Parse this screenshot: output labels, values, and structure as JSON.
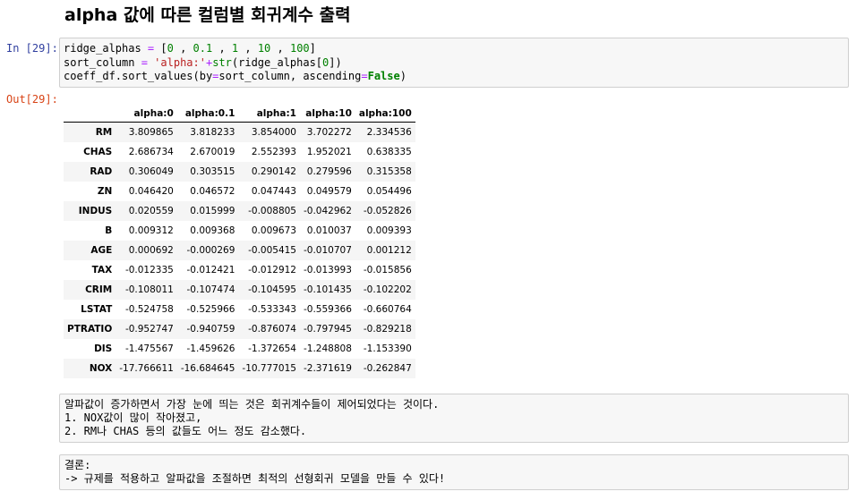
{
  "heading": "alpha 값에 따른 컬럼별 회귀계수 출력",
  "cell_in": {
    "prompt": "In [29]:",
    "line1": {
      "a": "ridge_alphas ",
      "b": "=",
      "c": " [",
      "d": "0",
      "e": " , ",
      "f": "0.1",
      "g": " , ",
      "h": "1",
      "i": " , ",
      "j": "10",
      "k": " , ",
      "l": "100",
      "m": "]"
    },
    "line2": {
      "a": "sort_column ",
      "b": "=",
      "c": " ",
      "d": "'alpha:'",
      "e": "+",
      "f": "str",
      "g": "(ridge_alphas[",
      "h": "0",
      "i": "])"
    },
    "line3": {
      "a": "coeff_df.sort_values(by",
      "b": "=",
      "c": "sort_column, ascending",
      "d": "=",
      "e": "False",
      "f": ")"
    }
  },
  "cell_out": {
    "prompt": "Out[29]:",
    "columns": [
      "",
      "alpha:0",
      "alpha:0.1",
      "alpha:1",
      "alpha:10",
      "alpha:100"
    ],
    "rows": [
      {
        "label": "RM",
        "values": [
          "3.809865",
          "3.818233",
          "3.854000",
          "3.702272",
          "2.334536"
        ]
      },
      {
        "label": "CHAS",
        "values": [
          "2.686734",
          "2.670019",
          "2.552393",
          "1.952021",
          "0.638335"
        ]
      },
      {
        "label": "RAD",
        "values": [
          "0.306049",
          "0.303515",
          "0.290142",
          "0.279596",
          "0.315358"
        ]
      },
      {
        "label": "ZN",
        "values": [
          "0.046420",
          "0.046572",
          "0.047443",
          "0.049579",
          "0.054496"
        ]
      },
      {
        "label": "INDUS",
        "values": [
          "0.020559",
          "0.015999",
          "-0.008805",
          "-0.042962",
          "-0.052826"
        ]
      },
      {
        "label": "B",
        "values": [
          "0.009312",
          "0.009368",
          "0.009673",
          "0.010037",
          "0.009393"
        ]
      },
      {
        "label": "AGE",
        "values": [
          "0.000692",
          "-0.000269",
          "-0.005415",
          "-0.010707",
          "0.001212"
        ]
      },
      {
        "label": "TAX",
        "values": [
          "-0.012335",
          "-0.012421",
          "-0.012912",
          "-0.013993",
          "-0.015856"
        ]
      },
      {
        "label": "CRIM",
        "values": [
          "-0.108011",
          "-0.107474",
          "-0.104595",
          "-0.101435",
          "-0.102202"
        ]
      },
      {
        "label": "LSTAT",
        "values": [
          "-0.524758",
          "-0.525966",
          "-0.533343",
          "-0.559366",
          "-0.660764"
        ]
      },
      {
        "label": "PTRATIO",
        "values": [
          "-0.952747",
          "-0.940759",
          "-0.876074",
          "-0.797945",
          "-0.829218"
        ]
      },
      {
        "label": "DIS",
        "values": [
          "-1.475567",
          "-1.459626",
          "-1.372654",
          "-1.248808",
          "-1.153390"
        ]
      },
      {
        "label": "NOX",
        "values": [
          "-17.766611",
          "-16.684645",
          "-10.777015",
          "-2.371619",
          "-0.262847"
        ]
      }
    ]
  },
  "md1": {
    "line1": "알파값이 증가하면서 가장 눈에 띄는 것은 회귀계수들이 제어되었다는 것이다.",
    "line2": "1. NOX값이 많이 작아졌고,",
    "line3": "2. RM나 CHAS 등의 값들도 어느 정도 감소했다."
  },
  "md2": {
    "line1": "결론:",
    "line2": "-> 규제를 적용하고 알파값을 조절하면 최적의 선형회귀 모델을 만들 수 있다!"
  },
  "colors": {
    "prompt_in": "#303f9f",
    "prompt_out": "#d84315",
    "cell_bg": "#f7f7f7",
    "cell_border": "#cfcfcf"
  }
}
